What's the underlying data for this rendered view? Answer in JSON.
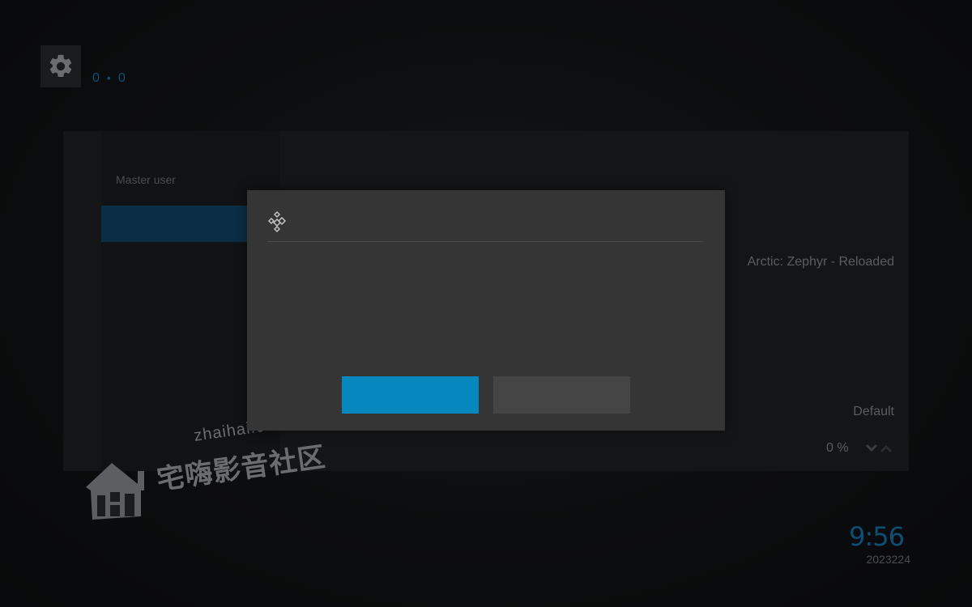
{
  "header": {
    "breadcrumb_left": "0",
    "breadcrumb_sep": "•",
    "breadcrumb_right": "0"
  },
  "background": {
    "sidebar_label": "Master user",
    "skin_value": "Arctic: Zephyr - Reloaded",
    "default_value": "Default",
    "percent_value": "0 %"
  },
  "dialog": {
    "primary_button_label": "",
    "secondary_button_label": ""
  },
  "clock": {
    "time": "9:56",
    "date": "2023224"
  },
  "watermark": {
    "url": "zhaihai.com",
    "name": "宅嗨影音社区"
  },
  "colors": {
    "accent_blue": "#0688bf",
    "dialog_bg": "#353535",
    "button_secondary": "#454545"
  },
  "icons": {
    "settings": "gear-icon",
    "dialog_logo": "kodi-logo-icon",
    "spin": "chevron-up-down-icon"
  }
}
